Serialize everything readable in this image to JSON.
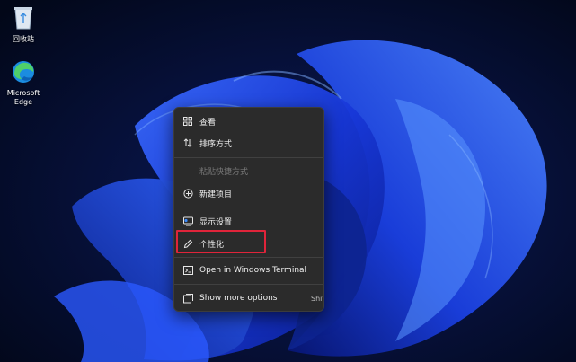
{
  "desktop": {
    "icons": [
      {
        "label": "回收站",
        "icon": "recycle-bin-icon"
      },
      {
        "label": "Microsoft Edge",
        "icon": "edge-icon"
      }
    ]
  },
  "context_menu": {
    "items": [
      {
        "label": "查看",
        "icon": "view-grid-icon",
        "enabled": true
      },
      {
        "label": "排序方式",
        "icon": "sort-icon",
        "enabled": true
      },
      {
        "label": "粘贴快捷方式",
        "icon": "",
        "enabled": false
      },
      {
        "label": "新建项目",
        "icon": "new-item-icon",
        "enabled": true
      },
      {
        "label": "显示设置",
        "icon": "display-settings-icon",
        "enabled": true
      },
      {
        "label": "个性化",
        "icon": "pencil-icon",
        "enabled": true,
        "highlighted": true
      },
      {
        "label": "Open in Windows Terminal",
        "icon": "terminal-icon",
        "enabled": true
      },
      {
        "label": "Show more options",
        "icon": "more-options-icon",
        "enabled": true,
        "shortcut": "Shift"
      }
    ]
  },
  "colors": {
    "menu_bg": "#2b2b2b",
    "highlight_border": "#e0243a",
    "wallpaper_accent": "#1f4fff"
  }
}
